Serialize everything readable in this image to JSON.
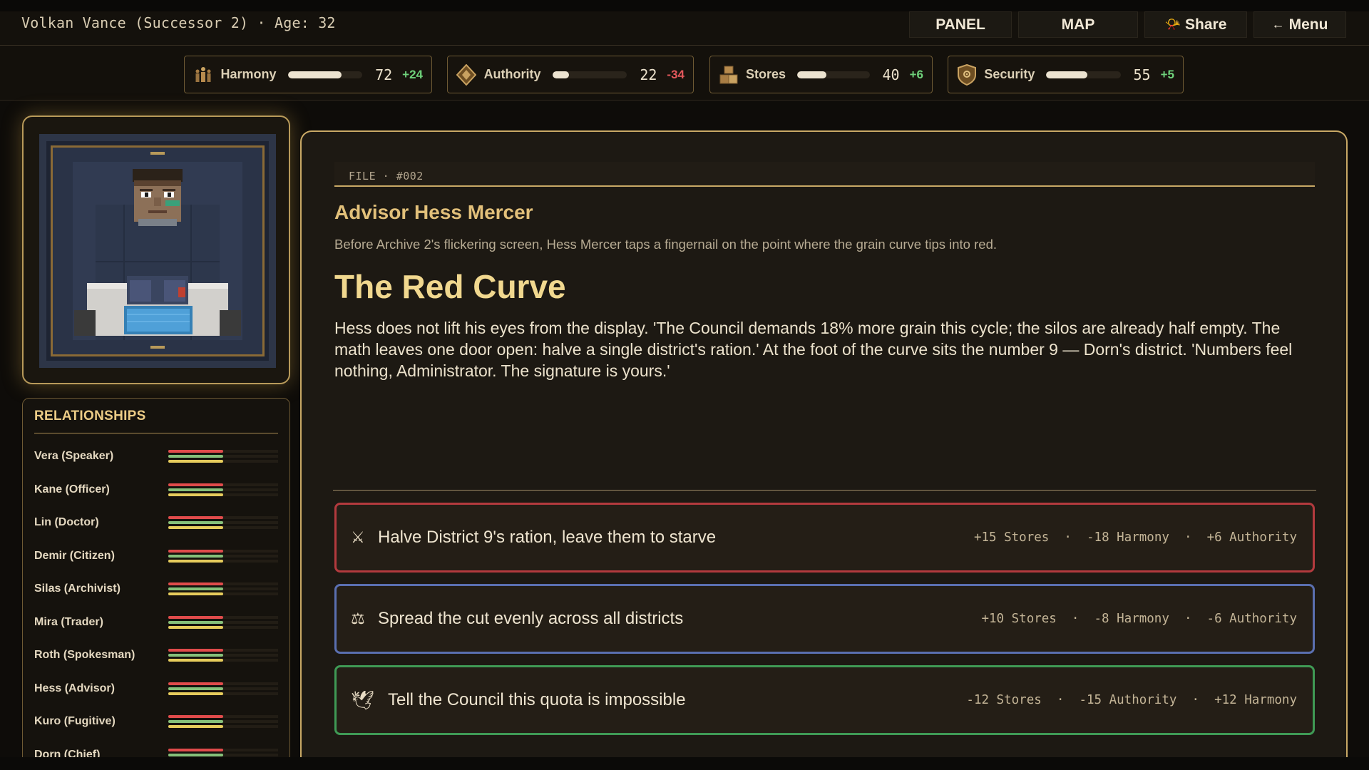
{
  "header": {
    "character": "Volkan Vance (Successor 2) · Age: 32",
    "nav": [
      {
        "label": "PANEL",
        "icon": ""
      },
      {
        "label": "MAP",
        "icon": ""
      },
      {
        "label": "Share",
        "icon": "📯"
      },
      {
        "label": "Menu",
        "icon": "←"
      }
    ]
  },
  "stats": [
    {
      "label": "Harmony",
      "value": "72",
      "delta": "+24",
      "level": 0.72,
      "icon": "people-icon"
    },
    {
      "label": "Authority",
      "value": "22",
      "delta": "-34",
      "level": 0.22,
      "icon": "diamond-icon"
    },
    {
      "label": "Stores",
      "value": "40",
      "delta": "+6",
      "level": 0.4,
      "icon": "crates-icon"
    },
    {
      "label": "Security",
      "value": "55",
      "delta": "+5",
      "level": 0.55,
      "icon": "shield-icon"
    }
  ],
  "relationships": {
    "title": "RELATIONSHIPS",
    "people": [
      {
        "name": "Vera (Speaker)"
      },
      {
        "name": "Kane (Officer)"
      },
      {
        "name": "Lin (Doctor)"
      },
      {
        "name": "Demir (Citizen)"
      },
      {
        "name": "Silas (Archivist)"
      },
      {
        "name": "Mira (Trader)"
      },
      {
        "name": "Roth (Spokesman)"
      },
      {
        "name": "Hess (Advisor)"
      },
      {
        "name": "Kuro (Fugitive)"
      },
      {
        "name": "Dorn (Chief)"
      }
    ]
  },
  "event": {
    "file_tag": "FILE · #002",
    "advisor": "Advisor Hess Mercer",
    "scene": "Before Archive 2's flickering screen, Hess Mercer taps a fingernail on the point where the grain curve tips into red.",
    "title": "The Red Curve",
    "body": "Hess does not lift his eyes from the display. 'The Council demands 18% more grain this cycle; the silos are already half empty. The math leaves one door open: halve a single district's ration.' At the foot of the curve sits the number 9 — Dorn's district. 'Numbers feel nothing, Administrator. The signature is yours.'"
  },
  "choices": [
    {
      "icon": "⚔",
      "icon_name": "swords-icon",
      "label": "Halve District 9's ration, leave them to starve",
      "effects": "+15 Stores  ·  -18 Harmony  ·  +6 Authority",
      "color": "#b33a3e"
    },
    {
      "icon": "⚖",
      "icon_name": "scales-icon",
      "label": "Spread the cut evenly across all districts",
      "effects": "+10 Stores  ·  -8 Harmony  ·  -6 Authority",
      "color": "#5a6fb0"
    },
    {
      "icon": "🕊",
      "icon_name": "dove-icon",
      "label": "Tell the Council this quota is impossible",
      "effects": "-12 Stores  ·  -15 Authority  ·  +12 Harmony",
      "color": "#3f9a55"
    }
  ],
  "colors": {
    "accent_gold": "#c9a966",
    "positive": "#6fd27b",
    "negative": "#e4585c",
    "rel_bar_red": "#e04b4b",
    "rel_bar_green": "#86c07a",
    "rel_bar_yellow": "#e6cc5c"
  }
}
